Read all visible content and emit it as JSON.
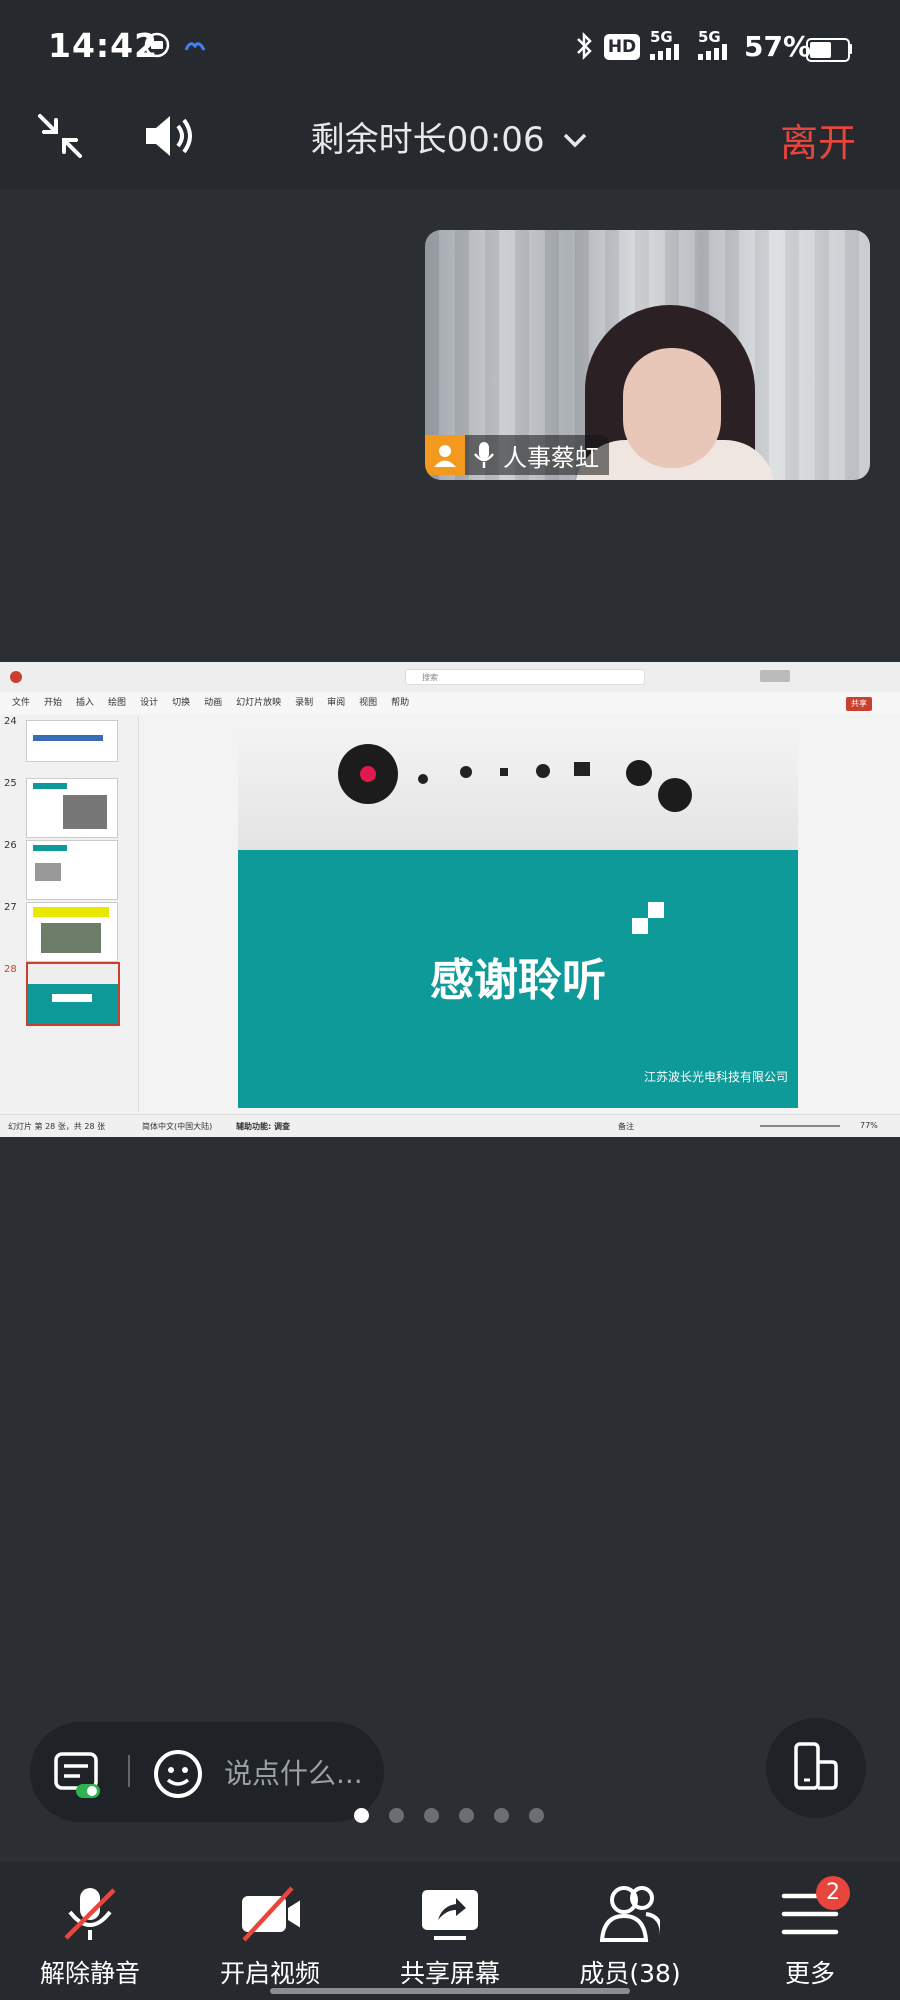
{
  "status_bar": {
    "time": "14:42",
    "network_1": "5G",
    "network_2": "5G",
    "hd_label": "HD",
    "battery_percent": "57%",
    "battery_level": 0.57,
    "icons": [
      "bluetooth-icon",
      "signal-icon",
      "battery-icon"
    ]
  },
  "call_header": {
    "remaining": "剩余时长00:06",
    "leave": "离开"
  },
  "video_tile": {
    "participant_name": "人事蔡虹"
  },
  "shared_screen": {
    "ppt_menu": [
      "文件",
      "开始",
      "插入",
      "绘图",
      "设计",
      "切换",
      "动画",
      "幻灯片放映",
      "录制",
      "审阅",
      "视图",
      "帮助"
    ],
    "search_placeholder": "搜索",
    "share_button": "共享",
    "thumbnails": [
      {
        "number": "24"
      },
      {
        "number": "25"
      },
      {
        "number": "26"
      },
      {
        "number": "27"
      },
      {
        "number": "28"
      }
    ],
    "slide": {
      "title": "感谢聆听",
      "company": "江苏波长光电科技有限公司"
    },
    "status_left": "幻灯片 第 28 张，共 28 张",
    "status_lang": "简体中文(中国大陆)",
    "status_access": "辅助功能: 调查",
    "status_notes": "备注",
    "zoom": "77%"
  },
  "chat": {
    "placeholder": "说点什么..."
  },
  "pager": {
    "count": 6,
    "active_index": 0
  },
  "toolbar": {
    "unmute": "解除静音",
    "start_video": "开启视频",
    "share_screen": "共享屏幕",
    "members": "成员(38)",
    "more": "更多",
    "more_badge": "2"
  }
}
